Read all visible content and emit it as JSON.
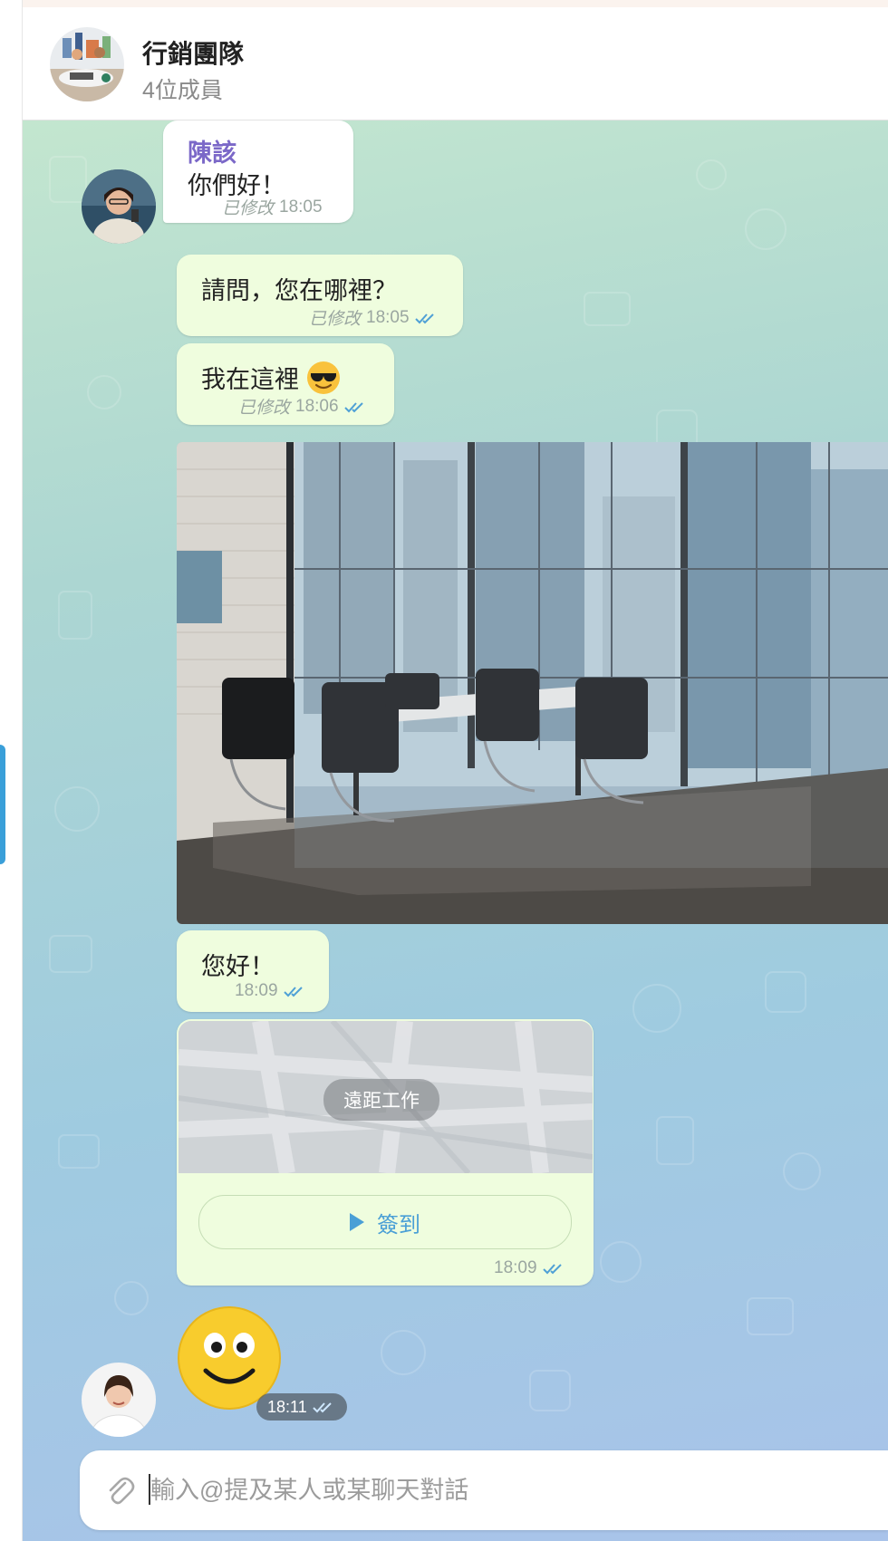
{
  "header": {
    "title": "行銷團隊",
    "subtitle": "4位成員"
  },
  "messages": {
    "m1": {
      "sender": "陳該",
      "text": "你們好！",
      "edited": "已修改",
      "time": "18:05"
    },
    "m2": {
      "text": "請問，您在哪裡？",
      "edited": "已修改",
      "time": "18:05"
    },
    "m3": {
      "text": "我在這裡",
      "edited": "已修改",
      "time": "18:06"
    },
    "m5": {
      "text": "您好！",
      "time": "18:09"
    },
    "m6": {
      "map_label": "遠距工作",
      "button_label": "簽到",
      "time": "18:09"
    },
    "m7": {
      "time": "18:11"
    }
  },
  "composer": {
    "placeholder": "輸入@提及某人或某聊天對話"
  },
  "icons": {
    "emoji": "sunglasses-emoji",
    "sticker": "smiley-face-sticker",
    "attach": "paperclip-icon",
    "read_status": "double-check-icon"
  },
  "colors": {
    "bubble_outgoing": "#effdde",
    "bubble_incoming": "#ffffff",
    "sender_name": "#7b68c8",
    "read_checks": "#4fae4e",
    "accent": "#4a9fd6"
  }
}
